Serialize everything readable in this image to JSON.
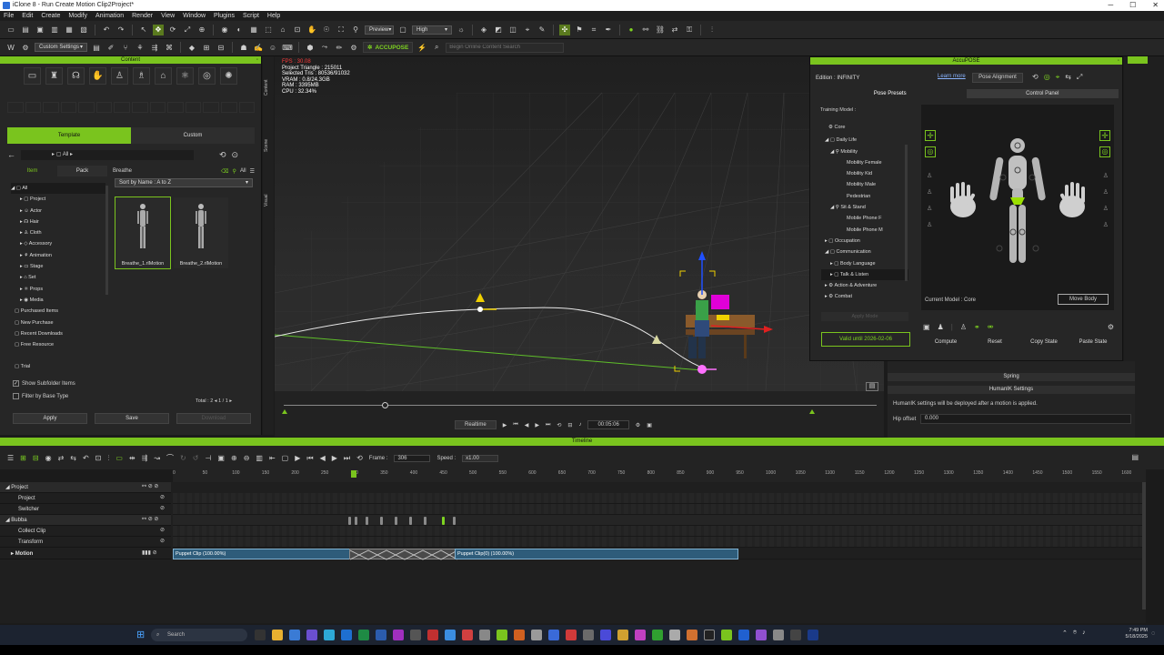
{
  "window": {
    "title": "iClone 8 - Run Create Motion Clip2Project*",
    "minimize": "─",
    "maximize": "☐",
    "close": "✕"
  },
  "menu": [
    "File",
    "Edit",
    "Create",
    "Modify",
    "Animation",
    "Render",
    "View",
    "Window",
    "Plugins",
    "Script",
    "Help"
  ],
  "toolbar1": {
    "render_mode": "Preview",
    "quality": "High"
  },
  "toolbar2": {
    "settings_dropdown": "Custom Settings",
    "accupose_label": "ACCUPOSE",
    "search_placeholder": "Begin Online Content Search"
  },
  "content": {
    "panel_title": "Content",
    "tabs": [
      "Template",
      "Custom"
    ],
    "path": "All",
    "subtabs": [
      "Item",
      "Pack"
    ],
    "pack_label": "Breathe",
    "all_label": "All",
    "sort": "Sort by Name : A to Z",
    "tree": [
      "All",
      "Project",
      "Actor",
      "Hair",
      "Cloth",
      "Accessory",
      "Animation",
      "Stage",
      "Set",
      "Props",
      "Media",
      "Purchased Items",
      "New Purchase",
      "Recent Downloads",
      "Free Resource",
      "Trial"
    ],
    "items": [
      "Breathe_1.rlMotion",
      "Breathe_2.rlMotion"
    ],
    "show_subfolder": "Show Subfolder Items",
    "filter_base": "Filter by Base Type",
    "total": "Total : 2",
    "pager": "1 / 1",
    "apply": "Apply",
    "save": "Save",
    "download": "Download"
  },
  "side_tabs": [
    "Content",
    "Scene",
    "Visual"
  ],
  "viewport": {
    "stats_fps": "FPS : 30.08",
    "stats_lines": [
      "Project Triangle : 215011",
      "Selected Tris : 80536/91032",
      "VRAM : 0.8/24.3GB",
      "RAM : 3395MB",
      "CPU : 32.34%"
    ]
  },
  "playback": {
    "mode": "Realtime",
    "time": "00:05:06"
  },
  "accupose": {
    "title": "AccuPOSE",
    "edition": "Edition : INFINITY",
    "learn_more": "Learn more",
    "pose_alignment": "Pose Alignment",
    "tabs": [
      "Pose Presets",
      "Control Panel"
    ],
    "training_model": "Training Model :",
    "tree": [
      "Core",
      "Daily Life",
      "Mobility",
      "Mobility Female",
      "Mobility Kid",
      "Mobility Male",
      "Pedestrian",
      "Sit & Stand",
      "Mobile Phone F",
      "Mobile Phone M",
      "Occupation",
      "Communication",
      "Body Language",
      "Talk & Listen",
      "Action & Adventure",
      "Combat"
    ],
    "apply_mode": "Apply Mode",
    "valid_until": "Valid until 2026-02-06",
    "current_model": "Current Model :  Core",
    "move_body": "Move Body",
    "buttons": [
      "Compute",
      "Reset",
      "Copy State",
      "Paste State"
    ]
  },
  "right_panel": {
    "spring": "Spring",
    "humanik": "HumanIK Settings",
    "note": "HumanIK settings will be deployed after a motion is applied.",
    "hip_offset_label": "Hip offset",
    "hip_offset_value": "0.000"
  },
  "timeline": {
    "title": "Timeline",
    "frame_label": "Frame :",
    "frame_value": "306",
    "speed_label": "Speed :",
    "speed_value": "x1.00",
    "ruler": [
      "0",
      "50",
      "100",
      "150",
      "200",
      "250",
      "300",
      "350",
      "400",
      "450",
      "500",
      "550",
      "600",
      "650",
      "700",
      "750",
      "800",
      "850",
      "900",
      "950",
      "1000",
      "1050",
      "1100",
      "1150",
      "1200",
      "1250",
      "1300",
      "1350",
      "1400",
      "1450",
      "1500",
      "1550",
      "1600"
    ],
    "tracks": [
      "Project",
      "Project",
      "Switcher",
      "Bubba",
      "Collect Clip",
      "Transform",
      "Motion"
    ],
    "clip1": "Puppet Clip (100.00%)",
    "clip2": "Puppet Clip(0) (100.00%)"
  },
  "taskbar": {
    "search": "Search",
    "time": "7:49 PM",
    "date": "5/18/2025"
  }
}
